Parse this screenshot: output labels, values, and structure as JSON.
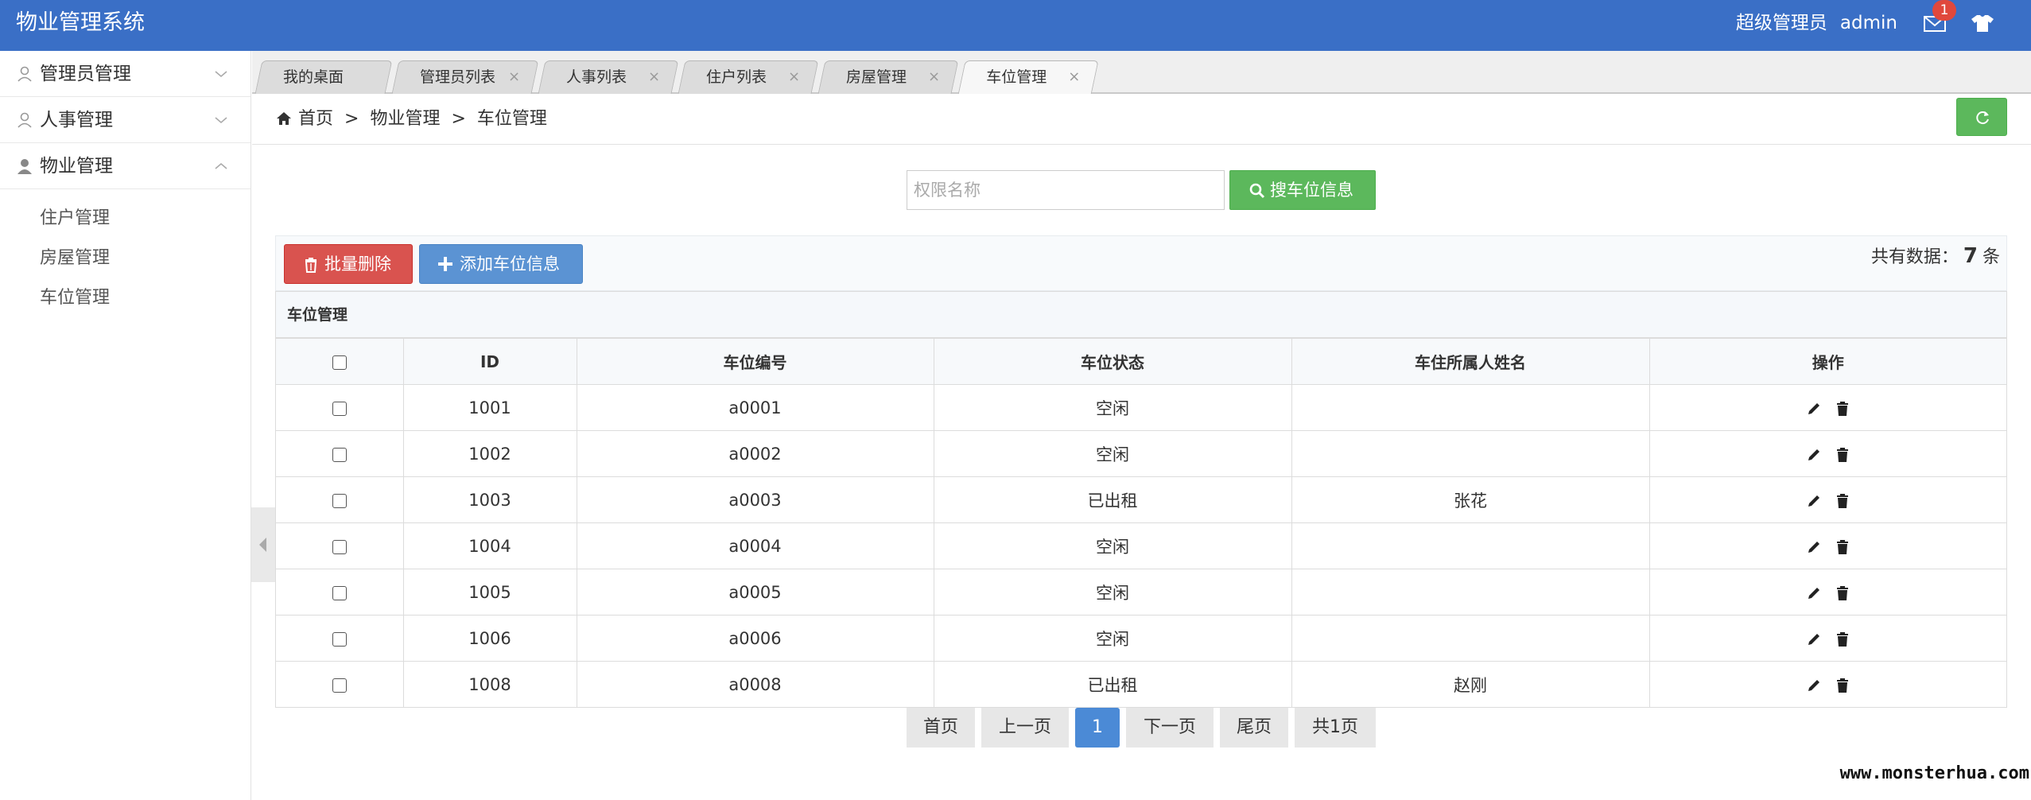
{
  "app": {
    "title": "物业管理系统"
  },
  "header": {
    "role": "超级管理员",
    "username": "admin",
    "mail_count": "1"
  },
  "sidebar": {
    "groups": [
      {
        "label": "管理员管理"
      },
      {
        "label": "人事管理"
      },
      {
        "label": "物业管理"
      }
    ],
    "sub_items": [
      "住户管理",
      "房屋管理",
      "车位管理"
    ]
  },
  "tabs": [
    {
      "label": "我的桌面"
    },
    {
      "label": "管理员列表"
    },
    {
      "label": "人事列表"
    },
    {
      "label": "住户列表"
    },
    {
      "label": "房屋管理"
    },
    {
      "label": "车位管理"
    }
  ],
  "breadcrumb": [
    "首页",
    "物业管理",
    "车位管理"
  ],
  "breadcrumb_sep": ">",
  "search": {
    "placeholder": "权限名称",
    "button_label": "搜车位信息"
  },
  "toolbar": {
    "delete_label": "批量删除",
    "add_label": "添加车位信息",
    "total_prefix": "共有数据：",
    "total_count": "7",
    "total_suffix": "条"
  },
  "table": {
    "title": "车位管理",
    "columns": [
      "ID",
      "车位编号",
      "车位状态",
      "车住所属人姓名",
      "操作"
    ],
    "rows": [
      {
        "id": "1001",
        "code": "a0001",
        "status": "空闲",
        "owner": ""
      },
      {
        "id": "1002",
        "code": "a0002",
        "status": "空闲",
        "owner": ""
      },
      {
        "id": "1003",
        "code": "a0003",
        "status": "已出租",
        "owner": "张花"
      },
      {
        "id": "1004",
        "code": "a0004",
        "status": "空闲",
        "owner": ""
      },
      {
        "id": "1005",
        "code": "a0005",
        "status": "空闲",
        "owner": ""
      },
      {
        "id": "1006",
        "code": "a0006",
        "status": "空闲",
        "owner": ""
      },
      {
        "id": "1008",
        "code": "a0008",
        "status": "已出租",
        "owner": "赵刚"
      }
    ]
  },
  "pagination": {
    "first": "首页",
    "prev": "上一页",
    "current": "1",
    "next": "下一页",
    "last": "尾页",
    "total": "共1页"
  },
  "watermark": "www.monsterhua.com",
  "colors": {
    "header": "#3a6fc6",
    "success": "#5cb85c",
    "danger": "#d9534f",
    "primary": "#5b93d3"
  }
}
